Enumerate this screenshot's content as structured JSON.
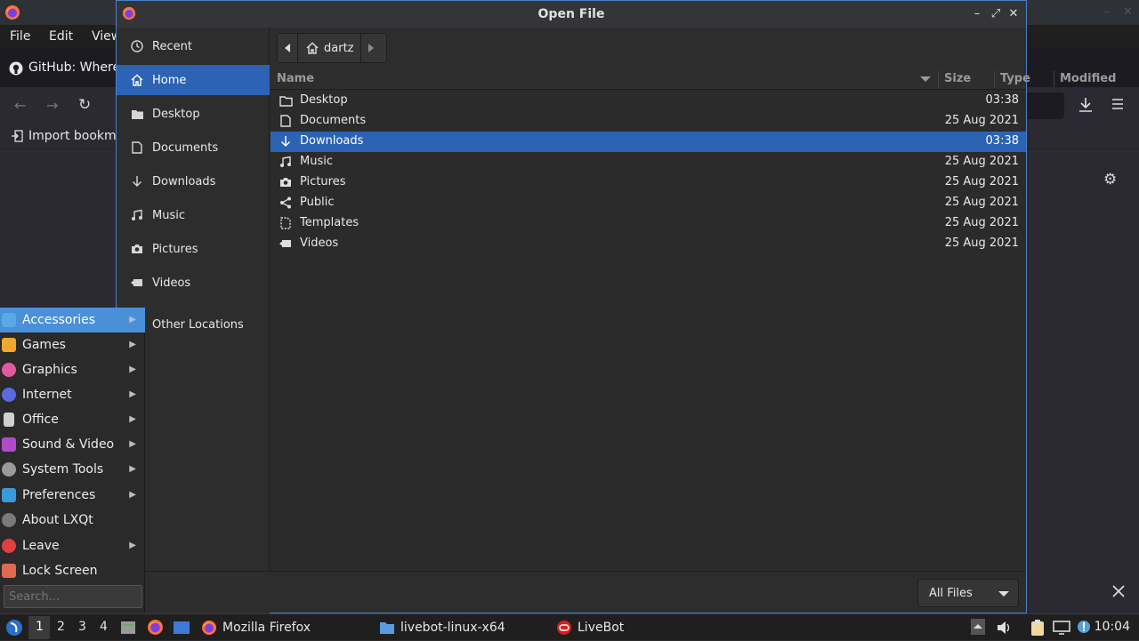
{
  "firefox": {
    "menus": [
      "File",
      "Edit",
      "View"
    ],
    "tab_title": "GitHub: Where",
    "bookmark_import": "Import bookma"
  },
  "dialog": {
    "title": "Open File",
    "sidebar": [
      {
        "label": "Recent",
        "icon": "clock-icon"
      },
      {
        "label": "Home",
        "icon": "home-icon",
        "active": true
      },
      {
        "label": "Desktop",
        "icon": "folder-icon"
      },
      {
        "label": "Documents",
        "icon": "document-icon"
      },
      {
        "label": "Downloads",
        "icon": "download-icon"
      },
      {
        "label": "Music",
        "icon": "music-icon"
      },
      {
        "label": "Pictures",
        "icon": "camera-icon"
      },
      {
        "label": "Videos",
        "icon": "video-icon"
      }
    ],
    "other_locations": "Other Locations",
    "path": {
      "current": "dartz"
    },
    "columns": {
      "name": "Name",
      "size": "Size",
      "type": "Type",
      "modified": "Modified"
    },
    "files": [
      {
        "name": "Desktop",
        "modified": "03:38",
        "icon": "folder-icon"
      },
      {
        "name": "Documents",
        "modified": "25 Aug 2021",
        "icon": "document-icon"
      },
      {
        "name": "Downloads",
        "modified": "03:38",
        "icon": "download-icon",
        "selected": true
      },
      {
        "name": "Music",
        "modified": "25 Aug 2021",
        "icon": "music-icon"
      },
      {
        "name": "Pictures",
        "modified": "25 Aug 2021",
        "icon": "camera-icon"
      },
      {
        "name": "Public",
        "modified": "25 Aug 2021",
        "icon": "share-icon"
      },
      {
        "name": "Templates",
        "modified": "25 Aug 2021",
        "icon": "template-icon"
      },
      {
        "name": "Videos",
        "modified": "25 Aug 2021",
        "icon": "video-icon"
      }
    ],
    "filter": "All Files"
  },
  "menu": {
    "items": [
      {
        "label": "Accessories",
        "submenu": true,
        "color": "#5aa9e6"
      },
      {
        "label": "Games",
        "submenu": true,
        "color": "#f0a830"
      },
      {
        "label": "Graphics",
        "submenu": true,
        "color": "#e05aa0"
      },
      {
        "label": "Internet",
        "submenu": true,
        "color": "#5a6ae0"
      },
      {
        "label": "Office",
        "submenu": true,
        "color": "#d0d0d0"
      },
      {
        "label": "Sound & Video",
        "submenu": true,
        "color": "#b04ac8"
      },
      {
        "label": "System Tools",
        "submenu": true,
        "color": "#9a9a9a"
      },
      {
        "label": "Preferences",
        "submenu": true,
        "color": "#3a9ad9"
      },
      {
        "label": "About LXQt",
        "submenu": false,
        "color": "#7a7a7a"
      },
      {
        "label": "Leave",
        "submenu": true,
        "color": "#e04040"
      },
      {
        "label": "Lock Screen",
        "submenu": false,
        "color": "#e06a50"
      }
    ],
    "search_placeholder": "Search..."
  },
  "taskbar": {
    "desktops": [
      "1",
      "2",
      "3",
      "4"
    ],
    "tasks": [
      {
        "label": "Mozilla Firefox"
      },
      {
        "label": "livebot-linux-x64"
      },
      {
        "label": "LiveBot"
      }
    ],
    "clock": "10:04"
  }
}
